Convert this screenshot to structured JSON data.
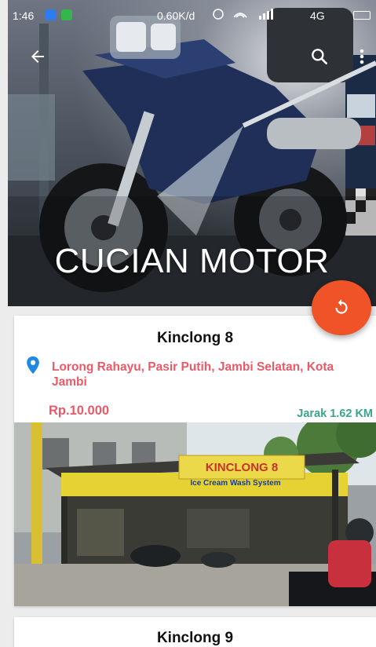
{
  "status_bar": {
    "time": "1:46",
    "net_speed": "0.60K/d",
    "network_label": "4G"
  },
  "header": {
    "title": "CUCIAN MOTOR"
  },
  "listings": [
    {
      "name": "Kinclong 8",
      "address": "Lorong Rahayu, Pasir Putih, Jambi Selatan, Kota Jambi",
      "price": "Rp.10.000",
      "distance": "Jarak 1.62 KM",
      "photo_sign": {
        "name": "KINCLONG 8",
        "tagline": "Ice Cream Wash System"
      }
    },
    {
      "name": "Kinclong 9"
    }
  ],
  "colors": {
    "accent_fab": "#ef5327",
    "price_address": "#e95a66",
    "distance": "#3aa58c",
    "location_pin": "#1e88e5"
  },
  "icons": [
    "back-arrow-icon",
    "search-icon",
    "more-vert-icon",
    "refresh-icon",
    "location-pin-icon"
  ]
}
